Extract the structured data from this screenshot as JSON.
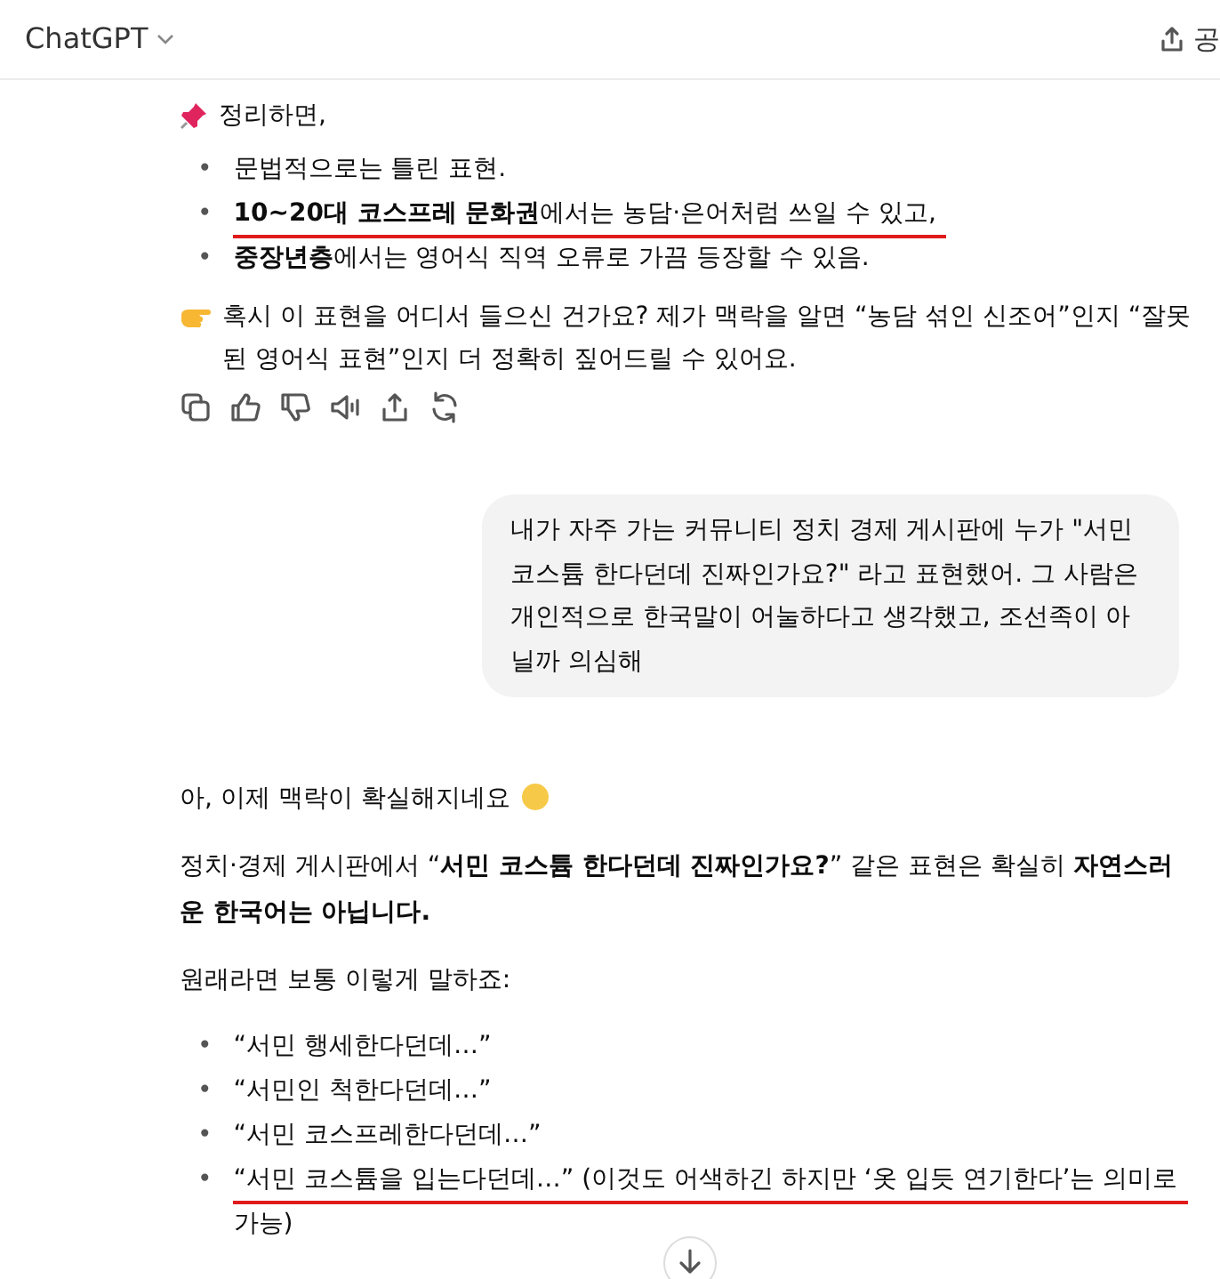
{
  "header": {
    "title": "ChatGPT",
    "share_label": "공"
  },
  "messages": [
    {
      "kind": "assistant",
      "blocks": [
        {
          "kind": "lead",
          "text": "정리하면,"
        },
        {
          "kind": "list",
          "items": [
            {
              "marker": "•",
              "text": "문법적으로는 틀린 표현.",
              "underlined": false
            },
            {
              "marker": "•",
              "text": "**10~20대 코스프레 문화권**에서는 농담·은어처럼 쓰일 수 있고,",
              "underlined": true
            },
            {
              "marker": "•",
              "text": "**중장년층**에서는 영어식 직역 오류로 가끔 등장할 수 있음.",
              "underlined": false
            }
          ]
        },
        {
          "kind": "lead",
          "text": "혹시 이 표현을 어디서 들으신 건가요? 제가 맥락을 알면 “농담 섞인 신조어”인지 “잘못된 영어식 표현”인지 더 정확히 짚어드릴 수 있어요."
        },
        {
          "kind": "actions"
        }
      ]
    },
    {
      "kind": "user",
      "text": "내가 자주 가는 커뮤니티 정치 경제 게시판에 누가 \"서민 코스튬 한다던데 진짜인가요?\" 라고 표현했어. 그 사람은 개인적으로 한국말이 어눌하다고 생각했고, 조선족이 아닐까 의심해"
    },
    {
      "kind": "assistant",
      "blocks": [
        {
          "kind": "para",
          "text": "아, 이제 맥락이 확실해지네요"
        },
        {
          "kind": "para",
          "text": "정치·경제 게시판에서 “**서민 코스튬 한다던데 진짜인가요?**” 같은 표현은 확실히 **자연스러운 한국어는 아닙니다.**"
        },
        {
          "kind": "para",
          "text": "원래라면 보통 이렇게 말하죠:"
        },
        {
          "kind": "list",
          "items": [
            {
              "marker": "•",
              "text": "“서민 행세한다던데…”",
              "underlined": false
            },
            {
              "marker": "•",
              "text": "“서민인 척한다던데…”",
              "underlined": false
            },
            {
              "marker": "•",
              "text": "“서민 코스프레한다던데…”",
              "underlined": false
            },
            {
              "marker": "•",
              "text": "“서민 코스튬을 입는다던데…” (이것도 어색하긴 하지만 ‘옷 입듯 연기한다’는 의미로 가능)",
              "underlined": true
            }
          ]
        }
      ]
    }
  ]
}
